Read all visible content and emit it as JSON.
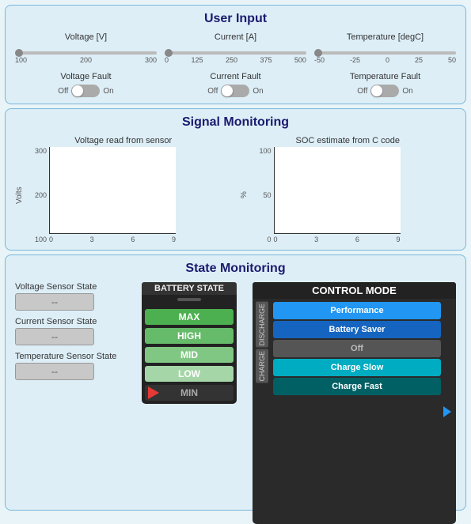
{
  "userInput": {
    "title": "User Input",
    "sliders": [
      {
        "label": "Voltage [V]",
        "min": 100,
        "max": 300,
        "ticks": [
          "100",
          "200",
          "300"
        ],
        "value": 100
      },
      {
        "label": "Current [A]",
        "min": 0,
        "max": 500,
        "ticks": [
          "0",
          "125",
          "250",
          "375",
          "500"
        ],
        "value": 0
      },
      {
        "label": "Temperature [degC]",
        "min": -50,
        "max": 50,
        "ticks": [
          "-50",
          "-25",
          "0",
          "25",
          "50"
        ],
        "value": -50
      }
    ],
    "faults": [
      {
        "label": "Voltage Fault",
        "off": "Off",
        "on": "On"
      },
      {
        "label": "Current Fault",
        "off": "Off",
        "on": "On"
      },
      {
        "label": "Temperature Fault",
        "off": "Off",
        "on": "On"
      }
    ]
  },
  "signalMonitoring": {
    "title": "Signal Monitoring",
    "charts": [
      {
        "title": "Voltage read from sensor",
        "yLabel": "Volts",
        "yTicks": [
          "300",
          "200",
          "100"
        ],
        "xTicks": [
          "0",
          "3",
          "6",
          "9"
        ]
      },
      {
        "title": "SOC estimate from C code",
        "yLabel": "%",
        "yTicks": [
          "100",
          "50",
          "0"
        ],
        "xTicks": [
          "0",
          "3",
          "6",
          "9"
        ]
      }
    ]
  },
  "stateMonitoring": {
    "title": "State Monitoring",
    "sensorStates": [
      {
        "label": "Voltage Sensor State",
        "value": "--"
      },
      {
        "label": "Current Sensor State",
        "value": "--"
      },
      {
        "label": "Temperature Sensor State",
        "value": "--"
      }
    ],
    "battery": {
      "title": "BATTERY STATE",
      "segments": [
        "MAX",
        "HIGH",
        "MID",
        "LOW",
        "MIN"
      ]
    },
    "controlMode": {
      "title": "CONTROL MODE",
      "dischargeLabel": "DISCHARGE",
      "chargeLabel": "CHARGE",
      "modes": {
        "discharge": [
          "Performance",
          "Battery Saver",
          "Off"
        ],
        "charge": [
          "Charge Slow",
          "Charge Fast"
        ]
      }
    }
  }
}
